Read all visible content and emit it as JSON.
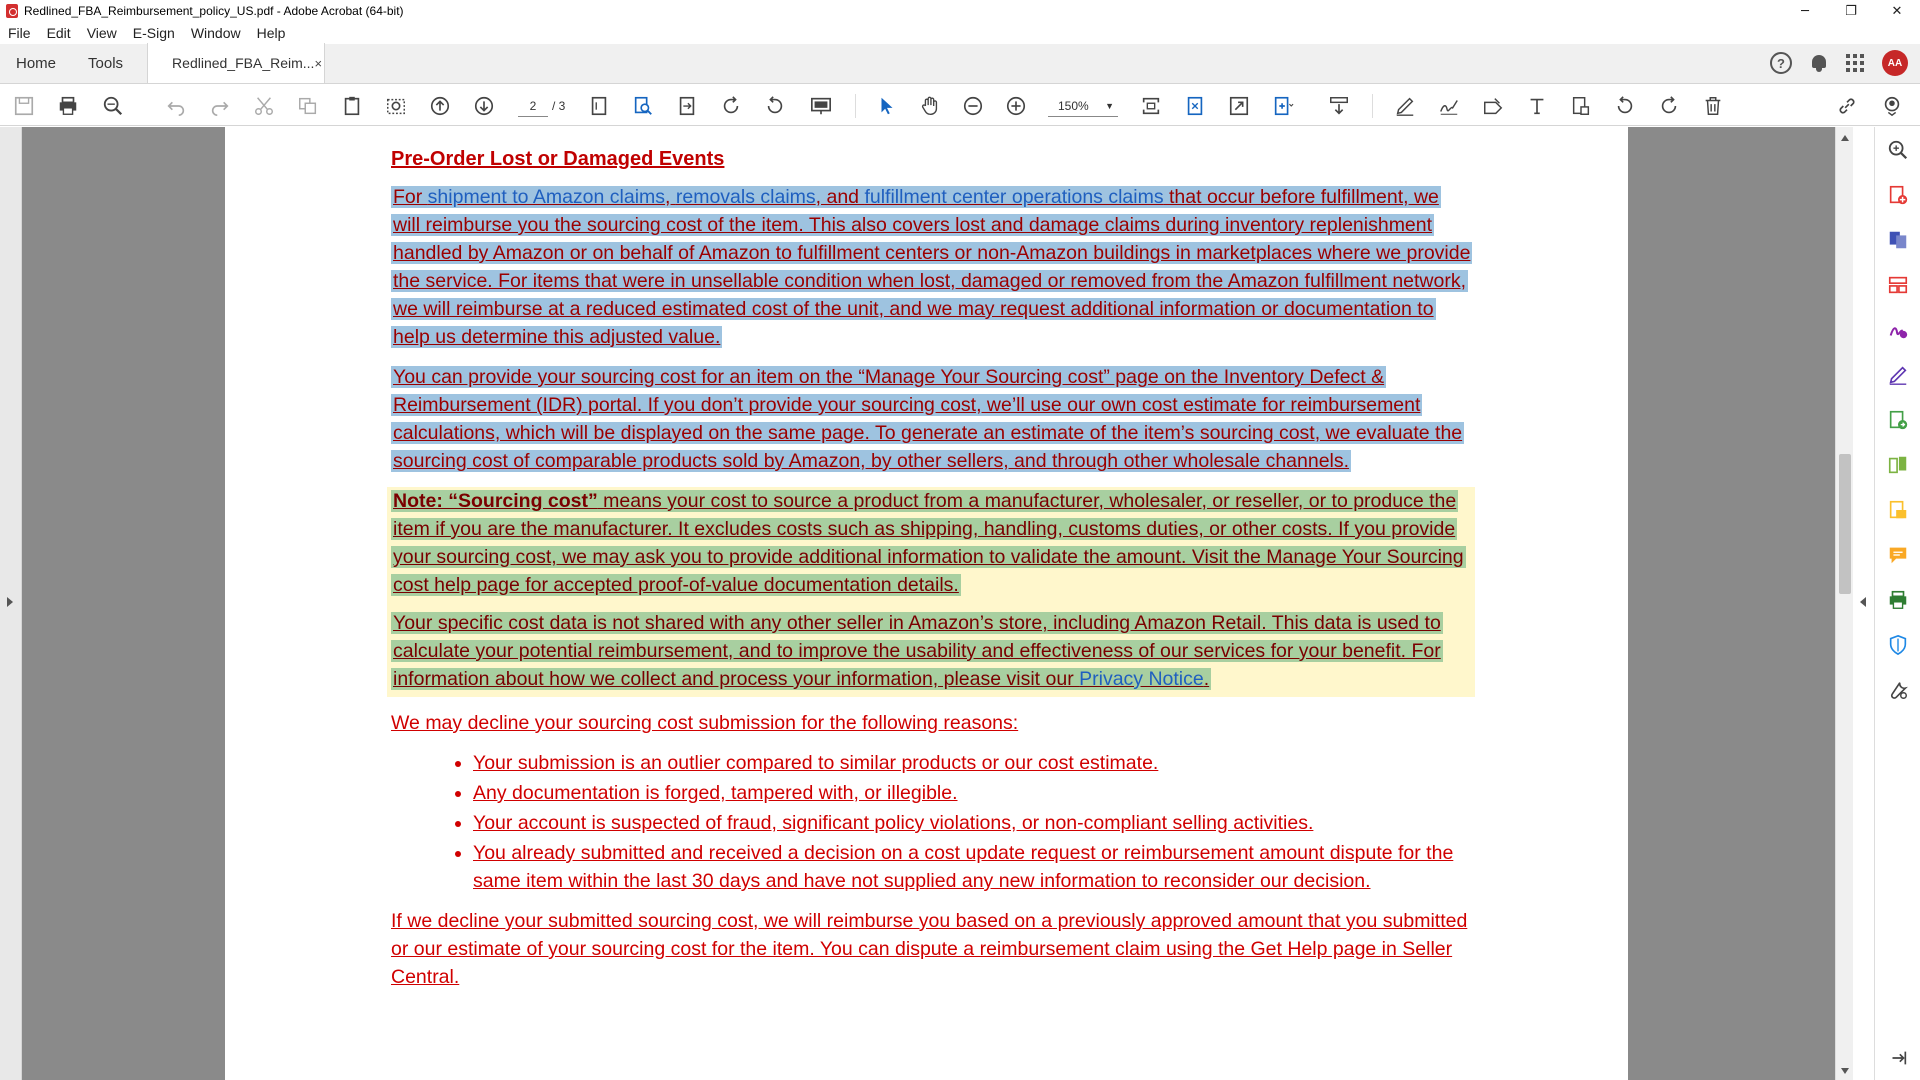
{
  "window": {
    "title": "Redlined_FBA_Reimbursement_policy_US.pdf - Adobe Acrobat (64-bit)",
    "minimize": "─",
    "restore": "❐",
    "close": "✕"
  },
  "menu": [
    "File",
    "Edit",
    "View",
    "E-Sign",
    "Window",
    "Help"
  ],
  "tabs": {
    "home": "Home",
    "tools": "Tools",
    "document": "Redlined_FBA_Reim...",
    "close": "×",
    "help_icon": "?",
    "avatar_text": "AA"
  },
  "toolbar": {
    "current_page": "2",
    "total_pages": "/ 3",
    "zoom": "150%"
  },
  "document": {
    "heading": "Pre-Order Lost or Damaged Events",
    "p1_prefix": "For ",
    "p1_link1": "shipment to Amazon claims",
    "p1_sep1": ", ",
    "p1_link2": "removals claims",
    "p1_sep2": ", and ",
    "p1_link3": "fulfillment center operations claims",
    "p1_rest": " that occur before fulfillment, we will reimburse you the sourcing cost of the item. This also covers lost and damage claims during inventory replenishment handled by Amazon or on behalf of Amazon to fulfillment centers or non-Amazon buildings in marketplaces where we provide the service. For items that were in unsellable condition when lost, damaged or removed from the Amazon fulfillment network, we will reimburse at a reduced estimated cost of the unit, and we may request additional information or documentation to help us determine this adjusted value.",
    "p2": "You can provide your sourcing cost for an item on the “Manage Your Sourcing cost” page on the Inventory Defect & Reimbursement (IDR) portal. If you don’t provide your sourcing cost, we’ll use our own cost estimate for reimbursement calculations, which will be displayed on the same page. To generate an estimate of the item’s sourcing cost, we evaluate the sourcing cost of comparable products sold by Amazon, by other sellers, and through other wholesale channels.",
    "note_label": "Note: “Sourcing cost”",
    "note_text": " means your cost to source a product from a manufacturer, wholesaler, or reseller, or to produce the item if you are the manufacturer. It excludes costs such as shipping, handling, customs duties, or other costs. If you provide your sourcing cost, we may ask you to provide additional information to validate the amount. Visit the Manage Your Sourcing cost help page for accepted proof-of-value documentation details.",
    "p4_text": "Your specific cost data is not shared with any other seller in Amazon’s store, including Amazon Retail. This data is used to calculate your potential reimbursement, and to improve the usability and effectiveness of our services for your benefit. For information about how we collect and process your information, please visit our ",
    "p4_link": "Privacy Notice",
    "p4_end": ".",
    "decline_intro": "We may decline your sourcing cost submission for the following reasons:",
    "bullets": [
      "Your submission is an outlier compared to similar products or our cost estimate.",
      "Any documentation is forged, tampered with, or illegible.",
      "Your account is suspected of fraud, significant policy violations, or non-compliant selling activities.",
      "You already submitted and received a decision on a cost update request or reimbursement amount dispute for the same item within the last 30 days and have not supplied any new information to reconsider our decision."
    ],
    "last_para": "If we decline your submitted sourcing cost, we will reimburse you based on a previously approved amount that you submitted or our estimate of your sourcing cost for the item. You can dispute a reimbursement claim using the Get Help page in Seller Central."
  },
  "colors": {
    "redline": "#d00000",
    "highlight_blue": "#9ec3e0",
    "highlight_green": "#a8cfa0",
    "note_background": "#fff7cc"
  },
  "icons": {
    "toolbar": [
      "save-icon",
      "print-icon",
      "zoom-search-icon",
      "undo-icon",
      "redo-icon",
      "cut-icon",
      "copy-icon",
      "paste-icon",
      "snapshot-icon",
      "page-up-icon",
      "page-down-icon",
      "page-icon",
      "search-doc-icon",
      "extract-icon",
      "rotate-cw-icon",
      "rotate-ccw-icon",
      "presentation-icon",
      "select-arrow-icon",
      "hand-icon",
      "zoom-out-icon",
      "zoom-in-icon",
      "fit-icon",
      "crop-icon",
      "expand-icon",
      "insert-page-icon",
      "download-icon",
      "highlight-pen-icon",
      "sign-icon",
      "stamp-icon",
      "text-icon",
      "export-icon",
      "undo2-icon",
      "redo2-icon",
      "delete-icon",
      "share-link-icon",
      "account-icon"
    ],
    "right_panel": [
      "zoom-panel-icon",
      "create-pdf-icon",
      "combine-icon",
      "organize-icon",
      "fill-sign-icon",
      "edit-icon",
      "export-pdf-icon",
      "compare-icon",
      "scan-icon",
      "comment-icon",
      "print-production-icon",
      "protect-icon",
      "more-tools-icon"
    ]
  }
}
